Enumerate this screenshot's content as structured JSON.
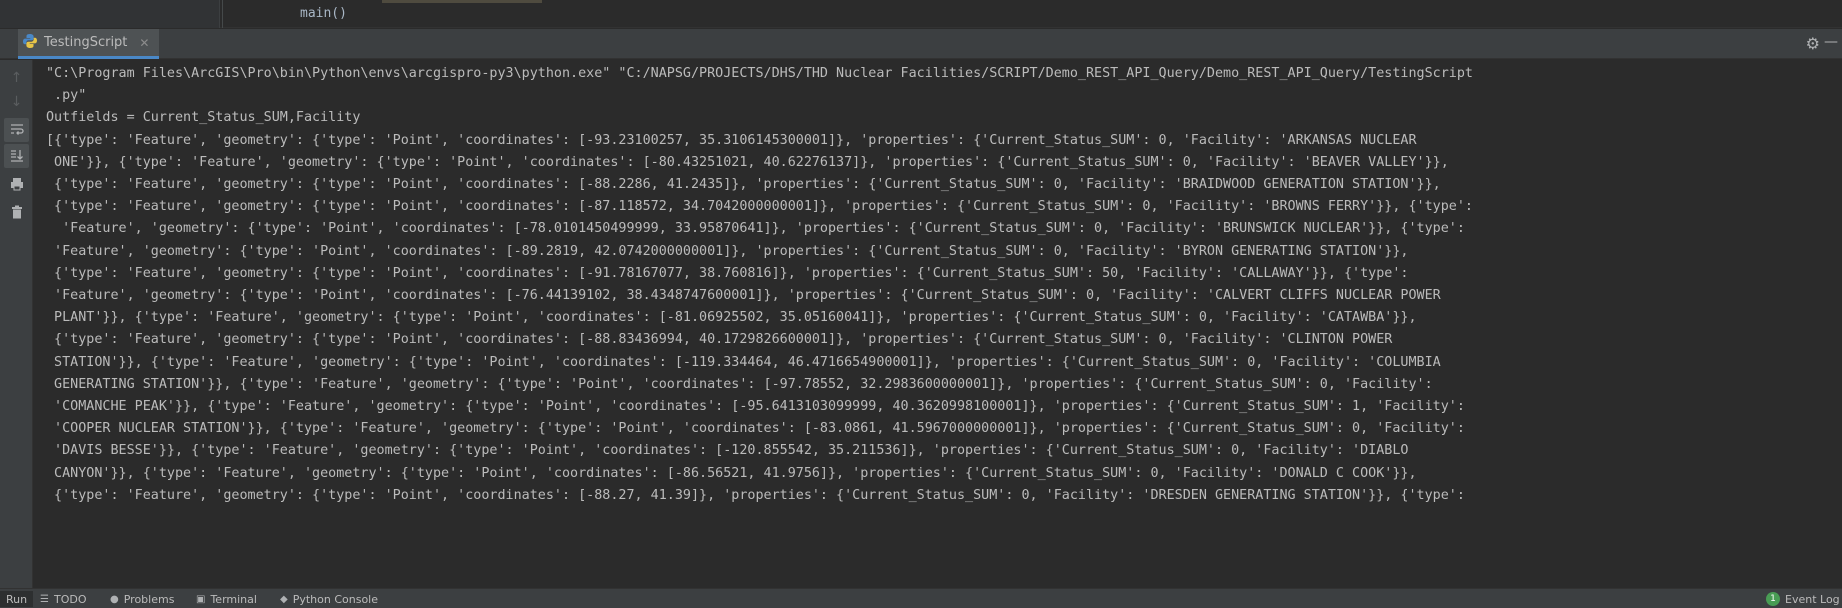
{
  "editor": {
    "breadcrumb": "main()"
  },
  "run_panel": {
    "tab_label": "TestingScript",
    "tab_icon": "python-icon",
    "settings_icon": "gear-icon",
    "minimize_icon": "minimize-icon"
  },
  "toolbar": {
    "icons": [
      "arrow-up-icon",
      "arrow-down-icon",
      "soft-wrap-icon",
      "scroll-to-end-icon",
      "print-icon",
      "trash-icon"
    ]
  },
  "console": {
    "lines": [
      "\"C:\\Program Files\\ArcGIS\\Pro\\bin\\Python\\envs\\arcgispro-py3\\python.exe\" \"C:/NAPSG/PROJECTS/DHS/THD Nuclear Facilities/SCRIPT/Demo_REST_API_Query/Demo_REST_API_Query/TestingScript",
      " .py\"",
      "Outfields = Current_Status_SUM,Facility",
      "[{'type': 'Feature', 'geometry': {'type': 'Point', 'coordinates': [-93.23100257, 35.3106145300001]}, 'properties': {'Current_Status_SUM': 0, 'Facility': 'ARKANSAS NUCLEAR",
      " ONE'}}, {'type': 'Feature', 'geometry': {'type': 'Point', 'coordinates': [-80.43251021, 40.62276137]}, 'properties': {'Current_Status_SUM': 0, 'Facility': 'BEAVER VALLEY'}},",
      " {'type': 'Feature', 'geometry': {'type': 'Point', 'coordinates': [-88.2286, 41.2435]}, 'properties': {'Current_Status_SUM': 0, 'Facility': 'BRAIDWOOD GENERATION STATION'}},",
      " {'type': 'Feature', 'geometry': {'type': 'Point', 'coordinates': [-87.118572, 34.7042000000001]}, 'properties': {'Current_Status_SUM': 0, 'Facility': 'BROWNS FERRY'}}, {'type':",
      "  'Feature', 'geometry': {'type': 'Point', 'coordinates': [-78.0101450499999, 33.95870641]}, 'properties': {'Current_Status_SUM': 0, 'Facility': 'BRUNSWICK NUCLEAR'}}, {'type':",
      " 'Feature', 'geometry': {'type': 'Point', 'coordinates': [-89.2819, 42.0742000000001]}, 'properties': {'Current_Status_SUM': 0, 'Facility': 'BYRON GENERATING STATION'}},",
      " {'type': 'Feature', 'geometry': {'type': 'Point', 'coordinates': [-91.78167077, 38.760816]}, 'properties': {'Current_Status_SUM': 50, 'Facility': 'CALLAWAY'}}, {'type':",
      " 'Feature', 'geometry': {'type': 'Point', 'coordinates': [-76.44139102, 38.4348747600001]}, 'properties': {'Current_Status_SUM': 0, 'Facility': 'CALVERT CLIFFS NUCLEAR POWER",
      " PLANT'}}, {'type': 'Feature', 'geometry': {'type': 'Point', 'coordinates': [-81.06925502, 35.05160041]}, 'properties': {'Current_Status_SUM': 0, 'Facility': 'CATAWBA'}},",
      " {'type': 'Feature', 'geometry': {'type': 'Point', 'coordinates': [-88.83436994, 40.1729826600001]}, 'properties': {'Current_Status_SUM': 0, 'Facility': 'CLINTON POWER",
      " STATION'}}, {'type': 'Feature', 'geometry': {'type': 'Point', 'coordinates': [-119.334464, 46.4716654900001]}, 'properties': {'Current_Status_SUM': 0, 'Facility': 'COLUMBIA",
      " GENERATING STATION'}}, {'type': 'Feature', 'geometry': {'type': 'Point', 'coordinates': [-97.78552, 32.2983600000001]}, 'properties': {'Current_Status_SUM': 0, 'Facility':",
      " 'COMANCHE PEAK'}}, {'type': 'Feature', 'geometry': {'type': 'Point', 'coordinates': [-95.6413103099999, 40.3620998100001]}, 'properties': {'Current_Status_SUM': 1, 'Facility':",
      " 'COOPER NUCLEAR STATION'}}, {'type': 'Feature', 'geometry': {'type': 'Point', 'coordinates': [-83.0861, 41.5967000000001]}, 'properties': {'Current_Status_SUM': 0, 'Facility':",
      " 'DAVIS BESSE'}}, {'type': 'Feature', 'geometry': {'type': 'Point', 'coordinates': [-120.855542, 35.211536]}, 'properties': {'Current_Status_SUM': 0, 'Facility': 'DIABLO",
      " CANYON'}}, {'type': 'Feature', 'geometry': {'type': 'Point', 'coordinates': [-86.56521, 41.9756]}, 'properties': {'Current_Status_SUM': 0, 'Facility': 'DONALD C COOK'}},",
      " {'type': 'Feature', 'geometry': {'type': 'Point', 'coordinates': [-88.27, 41.39]}, 'properties': {'Current_Status_SUM': 0, 'Facility': 'DRESDEN GENERATING STATION'}}, {'type':"
    ]
  },
  "bottom_bar": {
    "run_label": "Run",
    "todo_label": "TODO",
    "problems_label": "Problems",
    "terminal_label": "Terminal",
    "python_console_label": "Python Console",
    "event_log_label": "Event Log",
    "event_count": "1"
  }
}
